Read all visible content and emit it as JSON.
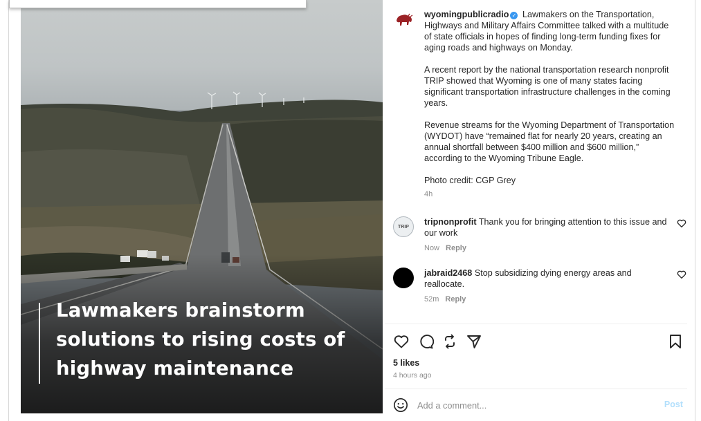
{
  "post": {
    "username": "wyomingpublicradio",
    "caption_p1": "Lawmakers on the Transportation, Highways and Military Affairs Committee talked with a multitude of state officials in hopes of finding long-term funding fixes for aging roads and highways on Monday.",
    "caption_p2": "A recent report by the national transportation research nonprofit TRIP showed that Wyoming is one of many states facing significant transportation infrastructure challenges in the coming years.",
    "caption_p3": "Revenue streams for the Wyoming Department of Transportation (WYDOT) have “remained flat for nearly 20 years, creating an annual shortfall between $400 million and $600 million,” according to the Wyoming Tribune Eagle.",
    "caption_p4": "Photo credit: CGP Grey",
    "time": "4h"
  },
  "image": {
    "headline": "Lawmakers brainstorm solutions to rising costs of highway maintenance"
  },
  "comments": [
    {
      "username": "tripnonprofit",
      "avatar_text": "TRIP",
      "text": "Thank you for bringing attention to this issue and our work",
      "time": "Now",
      "reply_label": "Reply"
    },
    {
      "username": "jabraid2468",
      "text": "Stop subsidizing dying energy areas and reallocate.",
      "time": "52m",
      "reply_label": "Reply"
    }
  ],
  "engagement": {
    "likes": "5 likes",
    "posted": "4 hours ago"
  },
  "comment_box": {
    "placeholder": "Add a comment...",
    "post_label": "Post"
  },
  "icons": [
    "heart-icon",
    "comment-icon",
    "repost-icon",
    "share-icon",
    "bookmark-icon",
    "emoji-icon",
    "verified-icon"
  ],
  "colors": {
    "verified": "#3897f0",
    "post_button": "#b2dffc",
    "muted": "#8e8e8e",
    "logo": "#9b2226"
  }
}
